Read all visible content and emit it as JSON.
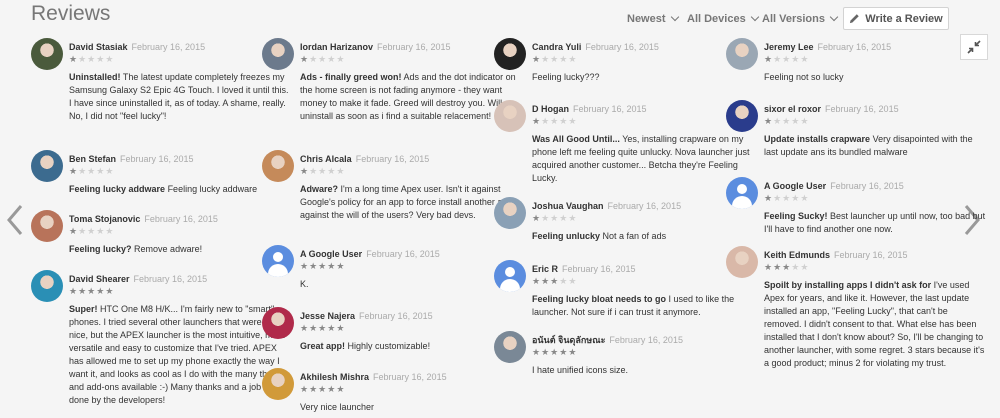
{
  "header": {
    "title": "Reviews",
    "sort": "Newest",
    "devices": "All Devices",
    "versions": "All Versions",
    "write_review": "Write a Review"
  },
  "columns": [
    [
      {
        "name": "David Stasiak",
        "date": "February 16, 2015",
        "rating": 1,
        "avatar": "photo",
        "bold": "Uninstalled!",
        "text": "The latest update completely freezes my Samsung Galaxy S2 Epic 4G Touch. I loved it until this. I have since uninstalled it, as of today. A shame, really. No, I did not \"feel lucky\"!"
      },
      {
        "name": "Ben Stefan",
        "date": "February 16, 2015",
        "rating": 1,
        "avatar": "photo",
        "bold": "Feeling lucky addware",
        "text": "Feeling lucky addware"
      },
      {
        "name": "Toma Stojanovic",
        "date": "February 16, 2015",
        "rating": 1,
        "avatar": "photo",
        "bold": "Feeling lucky?",
        "text": "Remove adware!"
      },
      {
        "name": "David Shearer",
        "date": "February 16, 2015",
        "rating": 5,
        "avatar": "photo",
        "bold": "Super!",
        "text": "HTC One M8 H/K... I'm fairly new to \"smart\" phones. I tried several other launchers that were very nice, but the APEX launcher is the most intuitive, most versatile and easy to customize that I've tried. APEX has allowed me to set up my phone exactly the way I want it, and looks as cool as I do with the many themes and add-ons available :-) Many thanks and a job well done by the developers!"
      }
    ],
    [
      {
        "name": "Iordan Harizanov",
        "date": "February 16, 2015",
        "rating": 1,
        "avatar": "photo",
        "bold": "Ads - finally greed won!",
        "text": "Ads and the dot indicator on the home screen is not fading anymore - they want money to make it fade. Greed will destroy you. Will uninstall as soon as i find a suitable relacement!"
      },
      {
        "name": "Chris Alcala",
        "date": "February 16, 2015",
        "rating": 1,
        "avatar": "photo",
        "bold": "Adware?",
        "text": "I'm a long time Apex user. Isn't it against Google's policy for an app to force install another app against the will of the users? Very bad devs."
      },
      {
        "name": "A Google User",
        "date": "February 16, 2015",
        "rating": 5,
        "avatar": "user",
        "bold": "",
        "text": "K."
      },
      {
        "name": "Jesse Najera",
        "date": "February 16, 2015",
        "rating": 5,
        "avatar": "photo",
        "bold": "Great app!",
        "text": "Highly customizable!"
      },
      {
        "name": "Akhilesh Mishra",
        "date": "February 16, 2015",
        "rating": 5,
        "avatar": "photo",
        "bold": "",
        "text": "Very nice launcher"
      }
    ],
    [
      {
        "name": "Candra Yuli",
        "date": "February 16, 2015",
        "rating": 1,
        "avatar": "photo",
        "bold": "",
        "text": "Feeling lucky???"
      },
      {
        "name": "D Hogan",
        "date": "February 16, 2015",
        "rating": 1,
        "avatar": "photo",
        "bold": "Was All Good Until...",
        "text": "Yes, installing crapware on my phone left me feeling quite unlucky. Nova launcher just acquired another customer... Betcha they're Feeling Lucky."
      },
      {
        "name": "Joshua Vaughan",
        "date": "February 16, 2015",
        "rating": 1,
        "avatar": "photo",
        "bold": "Feeling unlucky",
        "text": "Not a fan of ads"
      },
      {
        "name": "Eric R",
        "date": "February 16, 2015",
        "rating": 3,
        "avatar": "user",
        "bold": "Feeling lucky bloat needs to go",
        "text": "I used to like the launcher. Not sure if i can trust it anymore."
      },
      {
        "name": "อนันต์ จินดุลักษณะ",
        "date": "February 16, 2015",
        "rating": 5,
        "avatar": "photo",
        "bold": "",
        "text": "I hate unified icons size."
      }
    ],
    [
      {
        "name": "Jeremy Lee",
        "date": "February 16, 2015",
        "rating": 1,
        "avatar": "photo",
        "bold": "",
        "text": "Feeling not so lucky"
      },
      {
        "name": "sixor el roxor",
        "date": "February 16, 2015",
        "rating": 1,
        "avatar": "photo",
        "bold": "Update installs crapware",
        "text": "Very disapointed with the last update ans its bundled malware"
      },
      {
        "name": "A Google User",
        "date": "February 16, 2015",
        "rating": 1,
        "avatar": "user",
        "bold": "Feeling Sucky!",
        "text": "Best launcher up until now, too bad but I'll have to find another one now."
      },
      {
        "name": "Keith Edmunds",
        "date": "February 16, 2015",
        "rating": 3,
        "avatar": "photo",
        "bold": "Spoilt by installing apps I didn't ask for",
        "text": "I've used Apex for years, and like it. However, the last update installed an app, \"Feeling Lucky\", that can't be removed. I didn't consent to that. What else has been installed that I don't know about? So, I'll be changing to another launcher, with some regret. 3 stars because it's a good product; minus 2 for violating my trust."
      }
    ]
  ],
  "colors": {
    "background": "#f5f5f5",
    "star_on": "#888888",
    "star_off": "#d0d0d0",
    "default_avatar": "#5b8ddf"
  },
  "icons": {
    "write": "pencil-icon",
    "collapse": "collapse-icon",
    "prev": "chevron-left-icon",
    "next": "chevron-right-icon"
  }
}
